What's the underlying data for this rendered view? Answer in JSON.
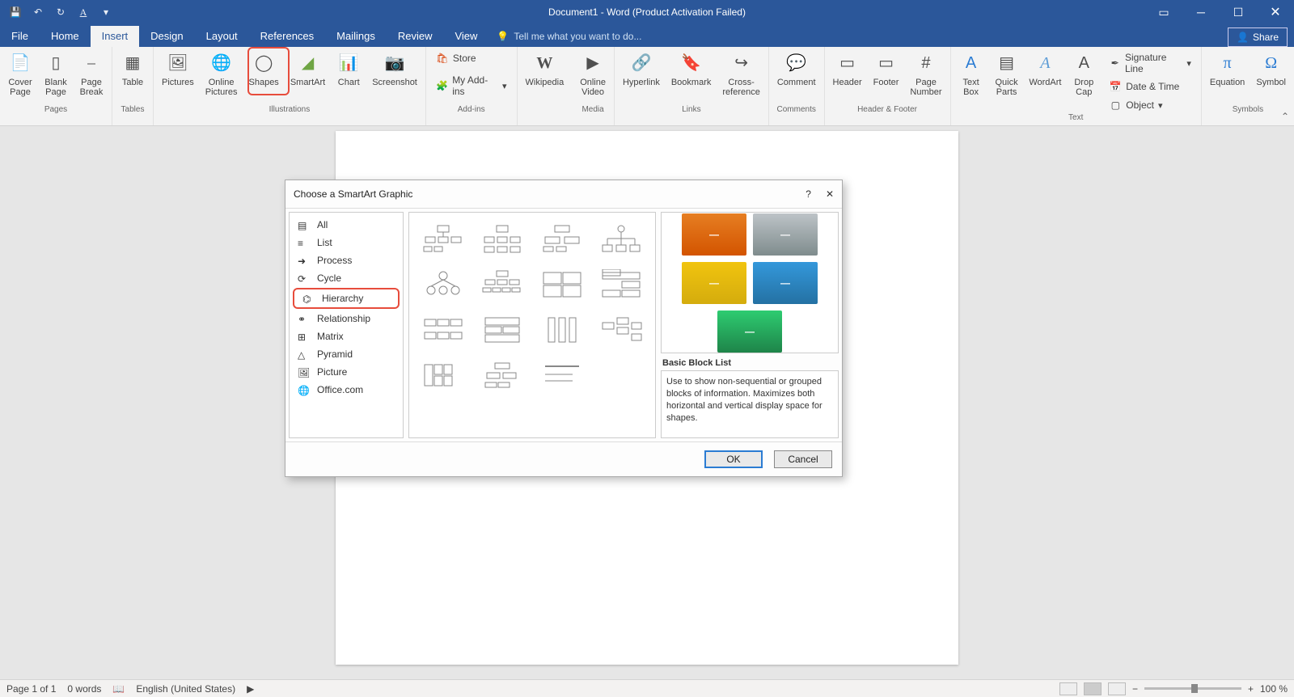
{
  "title": "Document1 - Word (Product Activation Failed)",
  "tabs": [
    "File",
    "Home",
    "Insert",
    "Design",
    "Layout",
    "References",
    "Mailings",
    "Review",
    "View"
  ],
  "tellme": "Tell me what you want to do...",
  "share": "Share",
  "ribbon": {
    "pages": {
      "cover": "Cover\nPage",
      "blank": "Blank\nPage",
      "break": "Page\nBreak",
      "label": "Pages"
    },
    "tables": {
      "table": "Table",
      "label": "Tables"
    },
    "illus": {
      "pictures": "Pictures",
      "online": "Online\nPictures",
      "shapes": "Shapes",
      "smartart": "SmartArt",
      "chart": "Chart",
      "screenshot": "Screenshot",
      "label": "Illustrations"
    },
    "addins": {
      "store": "Store",
      "my": "My Add-ins",
      "wiki": "Wikipedia",
      "label": "Add-ins"
    },
    "media": {
      "video": "Online\nVideo",
      "label": "Media"
    },
    "links": {
      "hyper": "Hyperlink",
      "bookmark": "Bookmark",
      "cross": "Cross-\nreference",
      "label": "Links"
    },
    "comments": {
      "comment": "Comment",
      "label": "Comments"
    },
    "hf": {
      "header": "Header",
      "footer": "Footer",
      "page": "Page\nNumber",
      "label": "Header & Footer"
    },
    "text": {
      "textbox": "Text\nBox",
      "quick": "Quick\nParts",
      "wordart": "WordArt",
      "drop": "Drop\nCap",
      "sig": "Signature Line",
      "date": "Date & Time",
      "obj": "Object",
      "label": "Text"
    },
    "symbols": {
      "eq": "Equation",
      "sym": "Symbol",
      "label": "Symbols"
    }
  },
  "dialog": {
    "title": "Choose a SmartArt Graphic",
    "cats": [
      "All",
      "List",
      "Process",
      "Cycle",
      "Hierarchy",
      "Relationship",
      "Matrix",
      "Pyramid",
      "Picture",
      "Office.com"
    ],
    "preview_title": "Basic Block List",
    "preview_desc": "Use to show non-sequential or grouped blocks of information. Maximizes both horizontal and vertical display space for shapes.",
    "ok": "OK",
    "cancel": "Cancel"
  },
  "status": {
    "page": "Page 1 of 1",
    "words": "0 words",
    "lang": "English (United States)",
    "zoom": "100 %"
  }
}
